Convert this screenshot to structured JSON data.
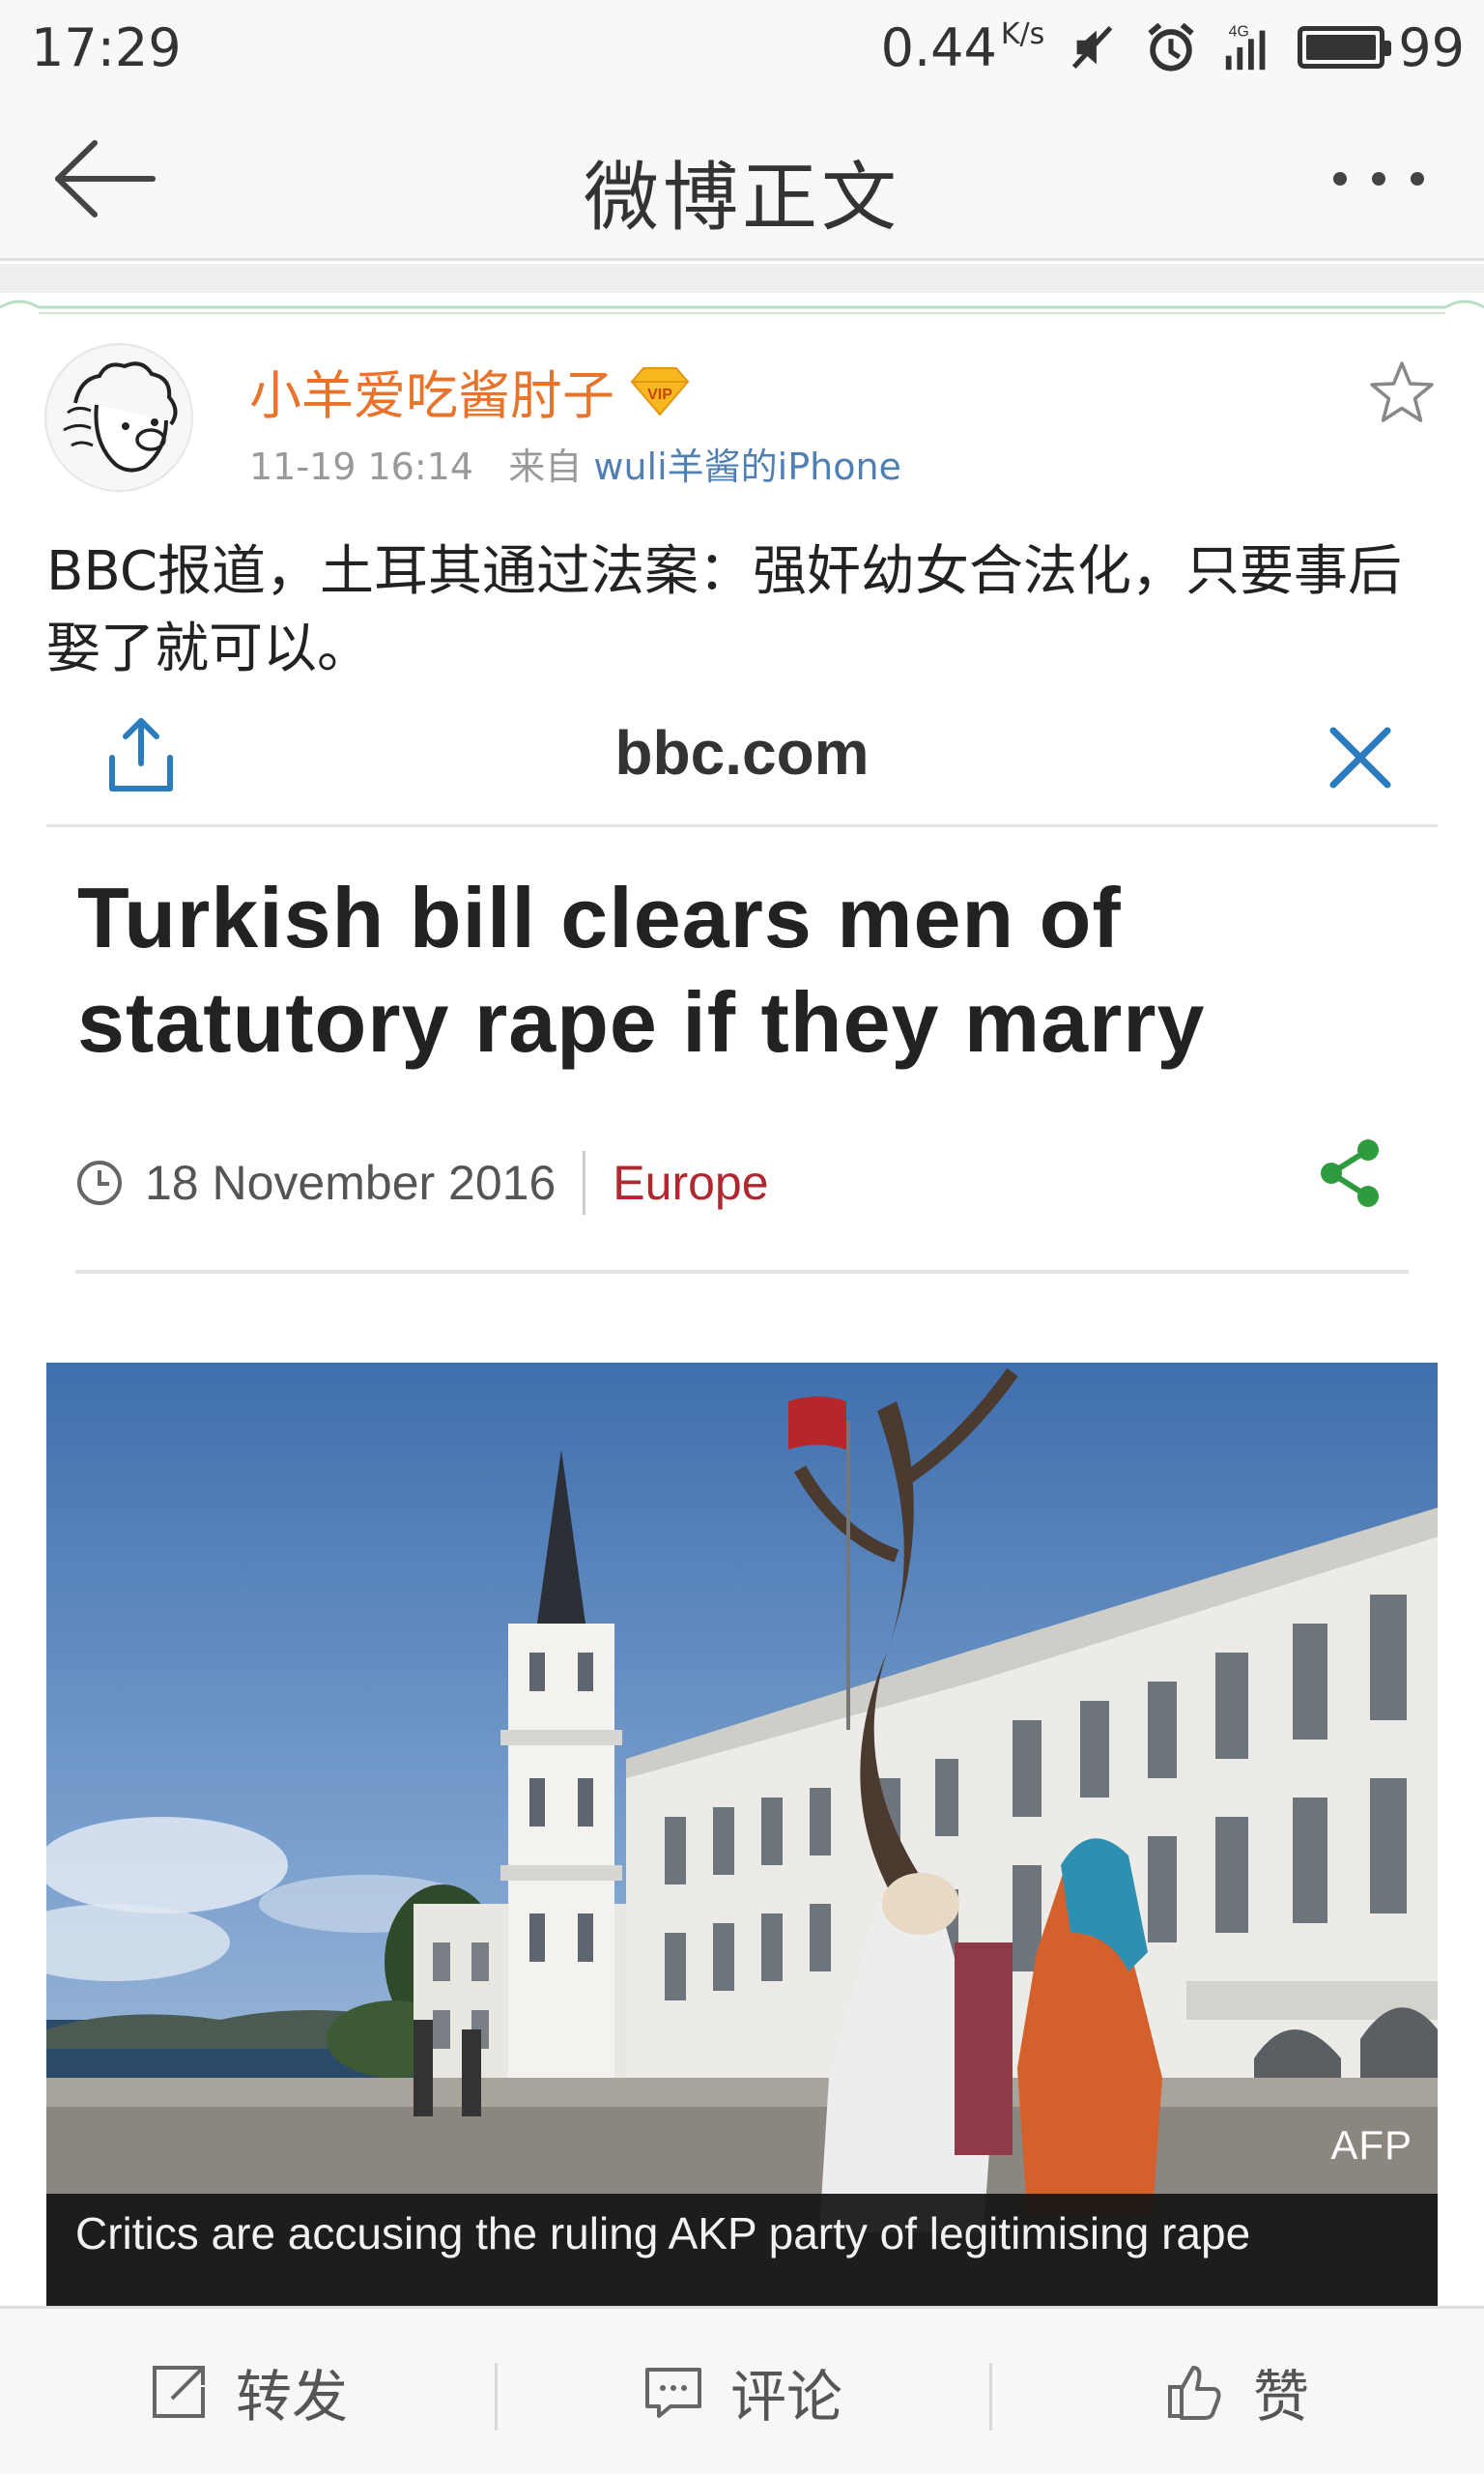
{
  "status_bar": {
    "time": "17:29",
    "net_speed": "0.44",
    "net_unit": "K/s",
    "network": "4G",
    "battery": "99",
    "battery_level": 0.99,
    "icons": [
      "mute-icon",
      "alarm-icon",
      "signal-icon",
      "battery-icon"
    ]
  },
  "nav": {
    "title": "微博正文",
    "back_icon": "back-arrow-icon",
    "more_icon": "more-dots-icon"
  },
  "post": {
    "username": "小羊爱吃酱肘子",
    "vip_badge": "VIP",
    "time": "11-19 16:14",
    "source_prefix": "来自",
    "source": "wuli羊酱的iPhone",
    "text": "BBC报道，土耳其通过法案：强奸幼女合法化，只要事后娶了就可以。",
    "favorite_icon": "star-icon"
  },
  "embed": {
    "domain": "bbc.com",
    "headline": "Turkish bill clears men of statutory rape if they marry",
    "date": "18 November 2016",
    "section": "Europe",
    "photo_credit": "AFP",
    "caption": "Critics are accusing the ruling AKP party of legitimising rape"
  },
  "toolbar": {
    "repost_label": "转发",
    "comment_label": "评论",
    "like_label": "赞"
  },
  "colors": {
    "username": "#e8732b",
    "source_link": "#4f7fb3",
    "bbc_share_blue": "#2b7bbd",
    "section_red": "#b0272e",
    "share_green": "#2e9b3e"
  }
}
